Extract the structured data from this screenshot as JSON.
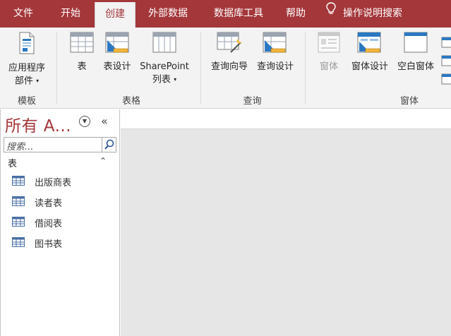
{
  "tabs": {
    "file": "文件",
    "home": "开始",
    "create": "创建",
    "external": "外部数据",
    "db_tools": "数据库工具",
    "help": "帮助",
    "tell_me": "操作说明搜索"
  },
  "ribbon": {
    "templates": {
      "app_parts_line1": "应用程序",
      "app_parts_line2": "部件",
      "group": "模板"
    },
    "tables": {
      "table": "表",
      "table_design": "表设计",
      "sharepoint_line1": "SharePoint",
      "sharepoint_line2": "列表",
      "group": "表格"
    },
    "queries": {
      "wizard": "查询向导",
      "design": "查询设计",
      "group": "查询"
    },
    "forms": {
      "form": "窗体",
      "form_design": "窗体设计",
      "blank_form": "空白窗体",
      "group": "窗体"
    }
  },
  "nav": {
    "title": "所有 A...",
    "search_placeholder": "搜索...",
    "category": "表",
    "items": [
      {
        "label": "出版商表"
      },
      {
        "label": "读者表"
      },
      {
        "label": "借阅表"
      },
      {
        "label": "图书表"
      }
    ]
  },
  "colors": {
    "accent": "#a4373a",
    "ribbon_bg": "#f3f3f3",
    "workspace_bg": "#e6e6e6"
  },
  "icons": [
    "lightbulb-icon",
    "application-parts-icon",
    "table-icon",
    "table-design-icon",
    "sharepoint-list-icon",
    "query-wizard-icon",
    "query-design-icon",
    "form-icon",
    "form-design-icon",
    "blank-form-icon",
    "search-icon",
    "chevron-down-icon",
    "collapse-icon"
  ]
}
